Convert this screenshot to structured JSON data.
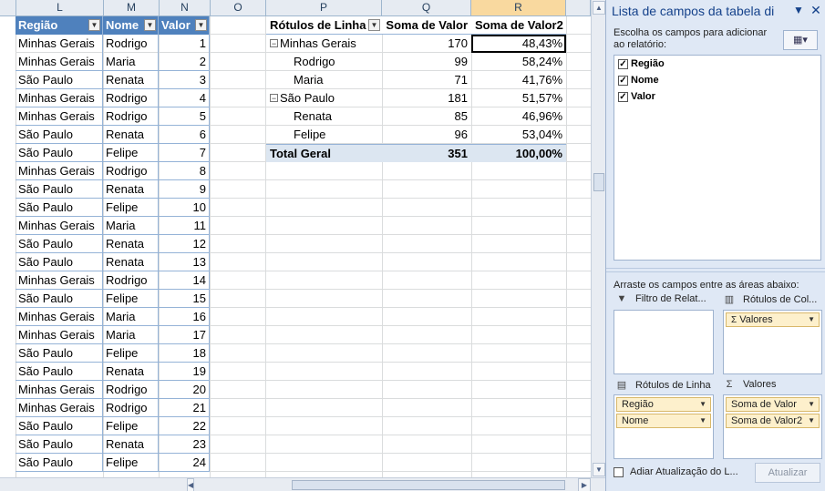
{
  "sheet": {
    "columns": [
      {
        "letter": "L"
      },
      {
        "letter": "M"
      },
      {
        "letter": "N"
      },
      {
        "letter": "O"
      },
      {
        "letter": "P"
      },
      {
        "letter": "Q"
      },
      {
        "letter": "R"
      }
    ],
    "table": {
      "headers": [
        "Região",
        "Nome",
        "Valor"
      ],
      "rows": [
        [
          "Minhas Gerais",
          "Rodrigo",
          "1"
        ],
        [
          "Minhas Gerais",
          "Maria",
          "2"
        ],
        [
          "São Paulo",
          "Renata",
          "3"
        ],
        [
          "Minhas Gerais",
          "Rodrigo",
          "4"
        ],
        [
          "Minhas Gerais",
          "Rodrigo",
          "5"
        ],
        [
          "São Paulo",
          "Renata",
          "6"
        ],
        [
          "São Paulo",
          "Felipe",
          "7"
        ],
        [
          "Minhas Gerais",
          "Rodrigo",
          "8"
        ],
        [
          "São Paulo",
          "Renata",
          "9"
        ],
        [
          "São Paulo",
          "Felipe",
          "10"
        ],
        [
          "Minhas Gerais",
          "Maria",
          "11"
        ],
        [
          "São Paulo",
          "Renata",
          "12"
        ],
        [
          "São Paulo",
          "Renata",
          "13"
        ],
        [
          "Minhas Gerais",
          "Rodrigo",
          "14"
        ],
        [
          "São Paulo",
          "Felipe",
          "15"
        ],
        [
          "Minhas Gerais",
          "Maria",
          "16"
        ],
        [
          "Minhas Gerais",
          "Maria",
          "17"
        ],
        [
          "São Paulo",
          "Felipe",
          "18"
        ],
        [
          "São Paulo",
          "Renata",
          "19"
        ],
        [
          "Minhas Gerais",
          "Rodrigo",
          "20"
        ],
        [
          "Minhas Gerais",
          "Rodrigo",
          "21"
        ],
        [
          "São Paulo",
          "Felipe",
          "22"
        ],
        [
          "São Paulo",
          "Renata",
          "23"
        ],
        [
          "São Paulo",
          "Felipe",
          "24"
        ]
      ]
    },
    "pivot": {
      "headers": [
        "Rótulos de Linha",
        "Soma de Valor",
        "Soma de Valor2"
      ],
      "rows": [
        {
          "kind": "group",
          "label": "Minhas Gerais",
          "sum": "170",
          "pct": "48,43%"
        },
        {
          "kind": "sub",
          "label": "Rodrigo",
          "sum": "99",
          "pct": "58,24%"
        },
        {
          "kind": "sub",
          "label": "Maria",
          "sum": "71",
          "pct": "41,76%"
        },
        {
          "kind": "group",
          "label": "São Paulo",
          "sum": "181",
          "pct": "51,57%"
        },
        {
          "kind": "sub",
          "label": "Renata",
          "sum": "85",
          "pct": "46,96%"
        },
        {
          "kind": "sub",
          "label": "Felipe",
          "sum": "96",
          "pct": "53,04%"
        }
      ],
      "total": {
        "label": "Total Geral",
        "sum": "351",
        "pct": "100,00%"
      }
    }
  },
  "pane": {
    "title": "Lista de campos da tabela di",
    "description": "Escolha os campos para adicionar ao relatório:",
    "fields": [
      {
        "label": "Região",
        "checked": true
      },
      {
        "label": "Nome",
        "checked": true
      },
      {
        "label": "Valor",
        "checked": true
      }
    ],
    "drag_text": "Arraste os campos entre as áreas abaixo:",
    "areas": {
      "filter_label": "Filtro de Relat...",
      "columns_label": "Rótulos de Col...",
      "rows_label": "Rótulos de Linha",
      "values_label": "Valores",
      "columns_items": [
        "Valores"
      ],
      "rows_items": [
        "Região",
        "Nome"
      ],
      "values_items": [
        "Soma de Valor",
        "Soma de Valor2"
      ]
    },
    "defer_label": "Adiar Atualização do L...",
    "update_label": "Atualizar"
  },
  "colors": {
    "table_header_bg": "#4f81bd",
    "table_border": "#95b3d7",
    "selected_column": "#f9d99f",
    "pane_bg": "#dfe8f5",
    "pill_bg": "#fdf0cc",
    "total_bg": "#dce6f1"
  }
}
